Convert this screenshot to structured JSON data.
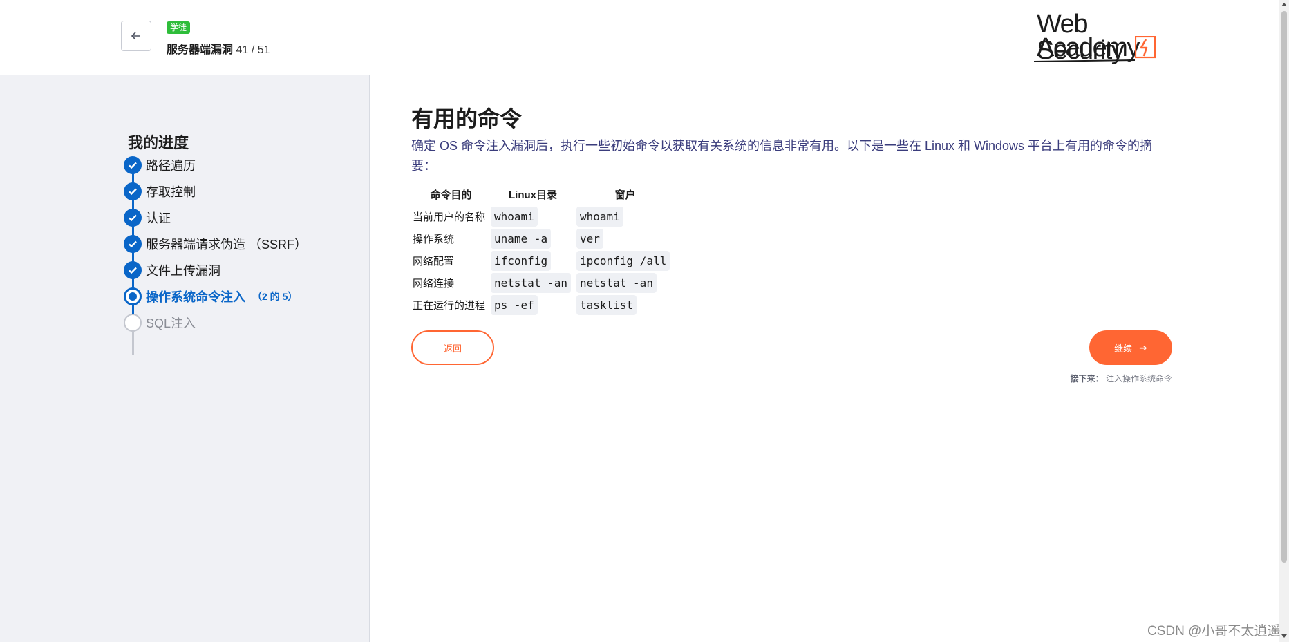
{
  "header": {
    "badge": "学徒",
    "topic_title": "服务器端漏洞",
    "topic_count": "41 / 51",
    "logo_line1": "Web Security",
    "logo_line2": "Academy"
  },
  "sidebar": {
    "title": "我的进度",
    "steps": [
      {
        "label": "路径遍历",
        "state": "done"
      },
      {
        "label": "存取控制",
        "state": "done"
      },
      {
        "label": "认证",
        "state": "done"
      },
      {
        "label": "服务器端请求伪造 （SSRF）",
        "state": "done"
      },
      {
        "label": "文件上传漏洞",
        "state": "done"
      },
      {
        "label": "操作系统命令注入",
        "state": "current",
        "sub": "（2 的 5）"
      },
      {
        "label": "SQL注入",
        "state": "todo"
      }
    ]
  },
  "main": {
    "heading": "有用的命令",
    "intro": "确定 OS 命令注入漏洞后，执行一些初始命令以获取有关系统的信息非常有用。以下是一些在 Linux 和 Windows 平台上有用的命令的摘要：",
    "table": {
      "headers": [
        "命令目的",
        "Linux目录",
        "窗户"
      ],
      "rows": [
        [
          "当前用户的名称",
          "whoami",
          "whoami"
        ],
        [
          "操作系统",
          "uname -a",
          "ver"
        ],
        [
          "网络配置",
          "ifconfig",
          "ipconfig /all"
        ],
        [
          "网络连接",
          "netstat -an",
          "netstat -an"
        ],
        [
          "正在运行的进程",
          "ps -ef",
          "tasklist"
        ]
      ]
    },
    "back_label": "返回",
    "continue_label": "继续",
    "next_label": "接下来：",
    "next_topic": "注入操作系统命令"
  },
  "watermark": "CSDN @小哥不太逍遥",
  "colors": {
    "accent_blue": "#0a66c8",
    "accent_orange": "#ff6633",
    "badge_green": "#2ebd3a",
    "sidebar_bg": "#f0f1f5"
  }
}
